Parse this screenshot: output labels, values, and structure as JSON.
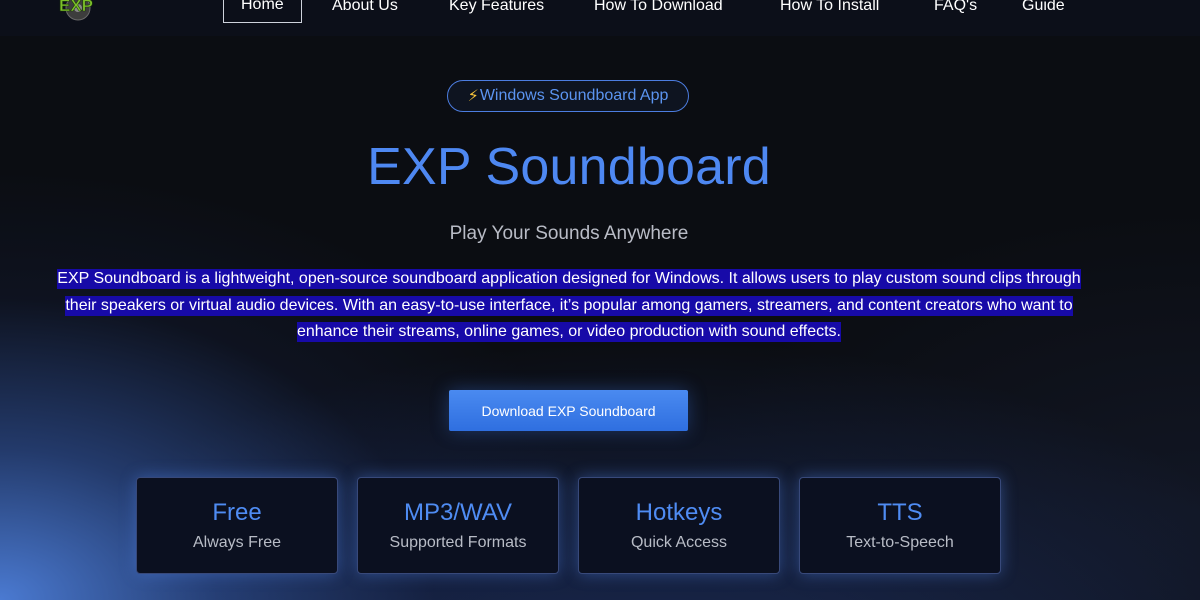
{
  "nav": {
    "logo_text": "EXP",
    "items": [
      {
        "label": "Home",
        "active": true
      },
      {
        "label": "About Us"
      },
      {
        "label": "Key Features"
      },
      {
        "label": "How To Download"
      },
      {
        "label": "How To Install"
      },
      {
        "label": "FAQ's"
      },
      {
        "label": "Guide"
      }
    ]
  },
  "hero": {
    "pill_icon": "⚡",
    "pill_label": "Windows Soundboard App",
    "title": "EXP Soundboard",
    "subtitle": "Play Your Sounds Anywhere",
    "description": "EXP Soundboard is a lightweight, open-source soundboard application designed for Windows. It allows users to play custom sound clips through their speakers or virtual audio devices. With an easy-to-use interface, it’s popular among gamers, streamers, and content creators who want to enhance their streams, online games, or video production with sound effects.",
    "download_label": "Download EXP Soundboard"
  },
  "features": [
    {
      "title": "Free",
      "subtitle": "Always Free"
    },
    {
      "title": "MP3/WAV",
      "subtitle": "Supported Formats"
    },
    {
      "title": "Hotkeys",
      "subtitle": "Quick Access"
    },
    {
      "title": "TTS",
      "subtitle": "Text-to-Speech"
    }
  ],
  "colors": {
    "accent": "#4e88f2",
    "highlight": "#170aa8",
    "button": "#3a7be8",
    "card_border": "#38497a"
  }
}
